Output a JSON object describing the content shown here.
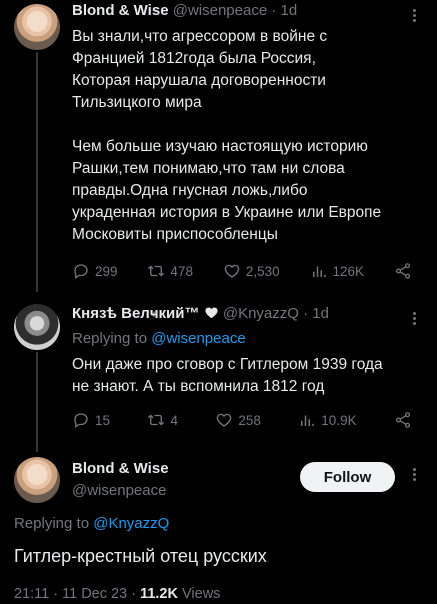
{
  "tweet1": {
    "display_name": "Blond & Wise",
    "handle": "@wisenpeace",
    "time": "· 1d",
    "text_lines": [
      "Вы знали,что агрессором в войне с",
      "Францией 1812года была Россия,",
      "Которая нарушала договоренности",
      "Тильзицкого мира",
      "",
      "Чем больше изучаю настоящую историю",
      "Рашки,тем понимаю,что там ни слова",
      "правды.Одна гнусная ложь,либо",
      "украденная история в Украине или Европе",
      "Московиты приспособленцы"
    ],
    "stats": {
      "replies": "299",
      "retweets": "478",
      "likes": "2,530",
      "views": "126K"
    }
  },
  "tweet2": {
    "display_name": "Князѣ Велҹкий™",
    "verified_icon": "heart-icon",
    "handle": "@KnyazzQ",
    "time": "· 1d",
    "replying_prefix": "Replying to",
    "replying_handle": "@wisenpeace",
    "text_lines": [
      "Они даже про сговор с Гитлером 1939 года",
      "не знают. А ты вспомнила 1812 год"
    ],
    "stats": {
      "replies": "15",
      "retweets": "4",
      "likes": "258",
      "views": "10.9K"
    }
  },
  "tweet3": {
    "display_name": "Blond & Wise",
    "handle": "@wisenpeace",
    "follow_label": "Follow",
    "replying_prefix": "Replying to",
    "replying_handle": "@KnyazzQ",
    "text": "Гитлер-крестный отец русских",
    "time": "21:11",
    "date": "11 Dec 23",
    "views_count": "11.2K",
    "views_label": "Views"
  }
}
